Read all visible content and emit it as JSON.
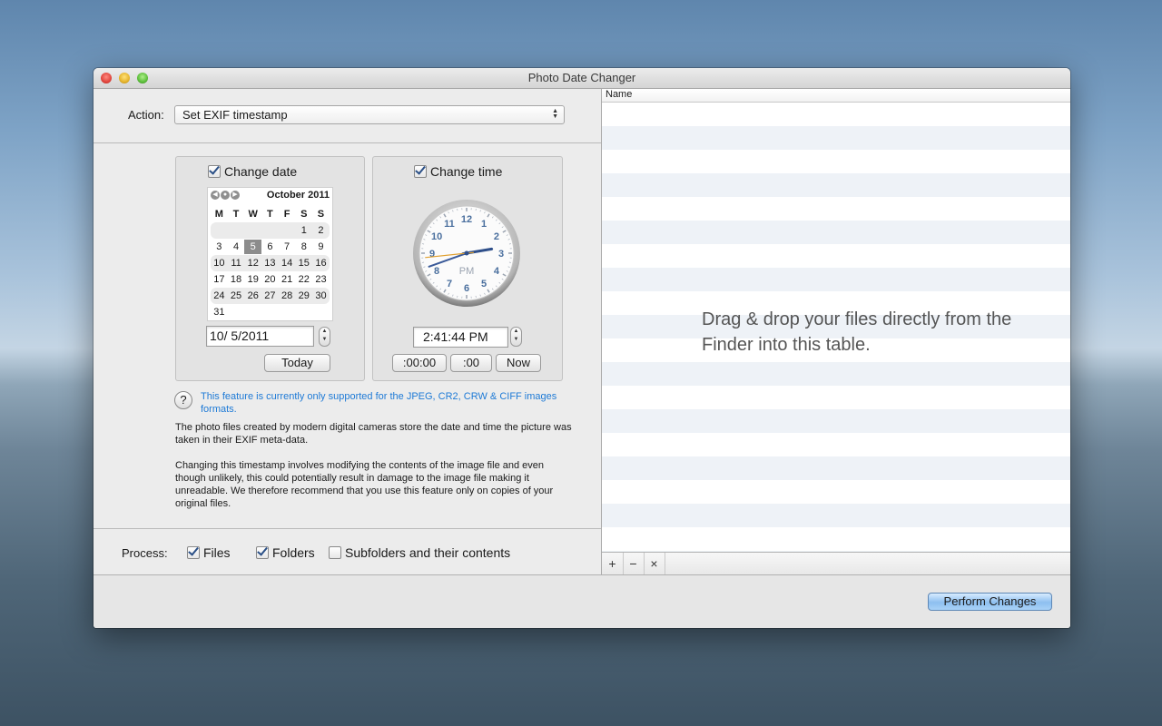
{
  "window": {
    "title": "Photo Date Changer"
  },
  "action": {
    "label": "Action:",
    "value": "Set EXIF timestamp"
  },
  "date_box": {
    "checkbox_label": "Change date",
    "checked": true,
    "calendar": {
      "month": "October 2011",
      "weekdays": [
        "M",
        "T",
        "W",
        "T",
        "F",
        "S",
        "S"
      ],
      "weeks": [
        [
          "",
          "",
          "",
          "",
          "",
          "1",
          "2"
        ],
        [
          "3",
          "4",
          "5",
          "6",
          "7",
          "8",
          "9"
        ],
        [
          "10",
          "11",
          "12",
          "13",
          "14",
          "15",
          "16"
        ],
        [
          "17",
          "18",
          "19",
          "20",
          "21",
          "22",
          "23"
        ],
        [
          "24",
          "25",
          "26",
          "27",
          "28",
          "29",
          "30"
        ],
        [
          "31",
          "",
          "",
          "",
          "",
          "",
          ""
        ]
      ],
      "selected_day": "5"
    },
    "date_value": "10/  5/2011",
    "today_button": "Today"
  },
  "time_box": {
    "checkbox_label": "Change time",
    "checked": true,
    "clock": {
      "numerals": [
        "12",
        "1",
        "2",
        "3",
        "4",
        "5",
        "6",
        "7",
        "8",
        "9",
        "10",
        "11"
      ],
      "period": "PM",
      "hour": 2,
      "minute": 41,
      "second": 44
    },
    "time_value": "2:41:44  PM",
    "buttons": [
      ":00:00",
      ":00",
      "Now"
    ]
  },
  "info": {
    "icon": "question-icon",
    "note": "This feature is currently only supported for the JPEG, CR2, CRW & CIFF images formats.",
    "para1": "The photo files created by modern digital cameras store the date and time the picture was taken in their EXIF meta-data.",
    "para2": "Changing this timestamp involves modifying the contents of the image file and even though unlikely, this could potentially result in damage to the image file making it unreadable. We therefore recommend that you use this feature only on copies of your original files."
  },
  "process": {
    "label": "Process:",
    "options": [
      {
        "label": "Files",
        "checked": true
      },
      {
        "label": "Folders",
        "checked": true
      },
      {
        "label": "Subfolders and their contents",
        "checked": false
      }
    ]
  },
  "table": {
    "column": "Name",
    "drop_message": "Drag & drop your files directly from the Finder into this table.",
    "footer_buttons": [
      "+",
      "−",
      "×"
    ]
  },
  "perform_button": "Perform Changes"
}
